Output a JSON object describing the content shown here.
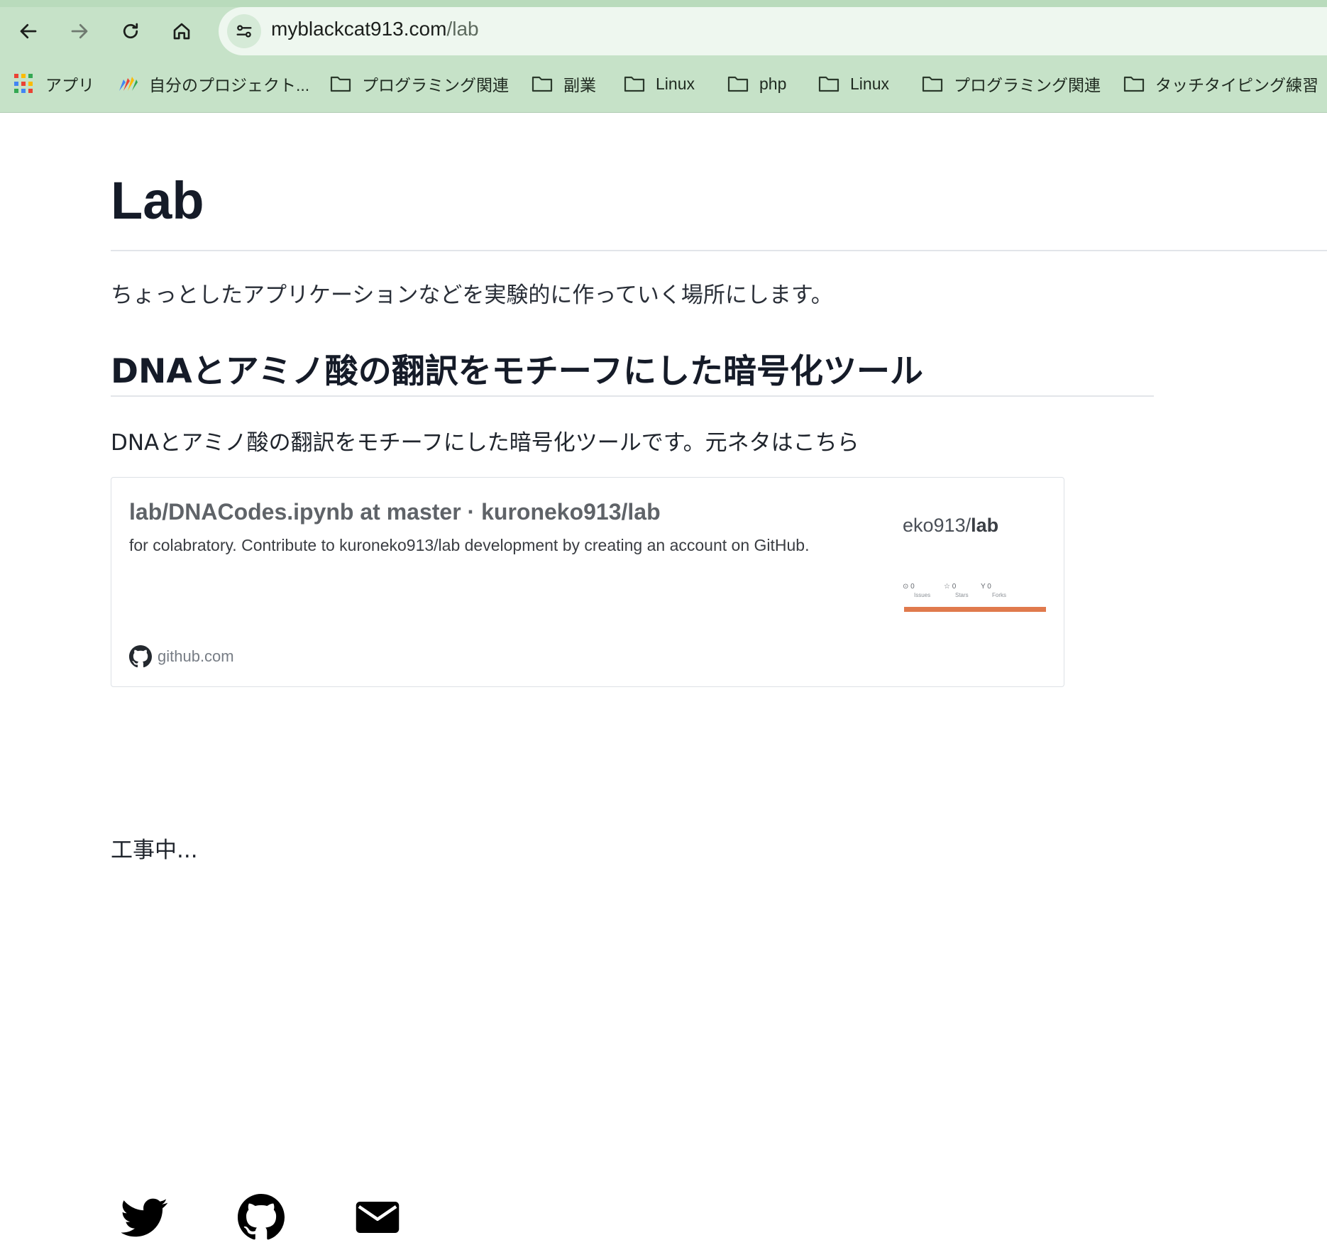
{
  "browser": {
    "url_host": "myblackcat913.com",
    "url_path": "/lab",
    "bookmarks": [
      {
        "icon": "apps-grid-icon",
        "label": "アプリ"
      },
      {
        "icon": "project-logo-icon",
        "label": "自分のプロジェクト..."
      },
      {
        "icon": "folder-icon",
        "label": "プログラミング関連"
      },
      {
        "icon": "folder-icon",
        "label": "副業"
      },
      {
        "icon": "folder-icon",
        "label": "Linux"
      },
      {
        "icon": "folder-icon",
        "label": "php"
      },
      {
        "icon": "folder-icon",
        "label": "Linux"
      },
      {
        "icon": "folder-icon",
        "label": "プログラミング関連"
      },
      {
        "icon": "folder-icon",
        "label": "タッチタイピング練習"
      }
    ],
    "colors": {
      "chrome": "#c6e2c8",
      "urlbar": "#eef7ef"
    }
  },
  "page": {
    "title": "Lab",
    "intro": "ちょっとしたアプリケーションなどを実験的に作っていく場所にします。",
    "section": {
      "heading": "DNAとアミノ酸の翻訳をモチーフにした暗号化ツール",
      "text": "DNAとアミノ酸の翻訳をモチーフにした暗号化ツールです。元ネタはこちら"
    },
    "card": {
      "title": "lab/DNACodes.ipynb at master · kuroneko913/lab",
      "description": "for colabratory. Contribute to kuroneko913/lab development by creating an account on GitHub.",
      "domain": "github.com",
      "thumb_repo_owner": "eko913/",
      "thumb_repo_name": "lab",
      "thumb_stats": [
        {
          "value": "0",
          "label": "Issues"
        },
        {
          "value": "0",
          "label": "Stars"
        },
        {
          "value": "0",
          "label": "Forks"
        }
      ],
      "accent": "#e07a4d"
    },
    "wip": "工事中...",
    "footer_icons": [
      "twitter-icon",
      "github-icon",
      "mail-icon"
    ]
  }
}
